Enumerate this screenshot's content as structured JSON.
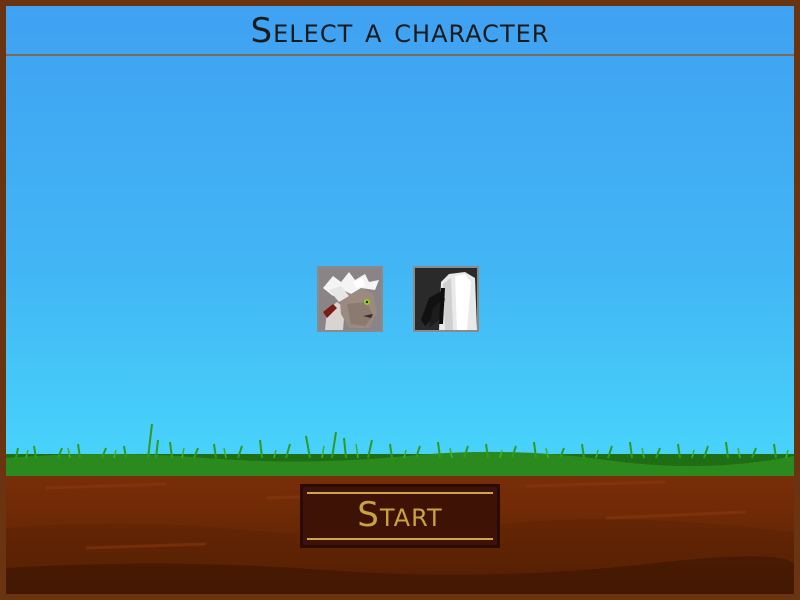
{
  "screen": {
    "title": "Select a character"
  },
  "characters": [
    {
      "name": "white-haired-creature-portrait",
      "icon": "white-haired-creature-icon"
    },
    {
      "name": "black-white-feathered-portrait",
      "icon": "black-white-feather-icon"
    }
  ],
  "start_button": {
    "label": "Start"
  },
  "colors": {
    "sky_top": "#3fa1f2",
    "sky_bottom": "#4bd9fc",
    "grass": "#2b8a1e",
    "dirt": "#6f2a06",
    "frame": "#6b3410",
    "button_bg": "#3e1205",
    "button_text": "#c9a43c"
  }
}
